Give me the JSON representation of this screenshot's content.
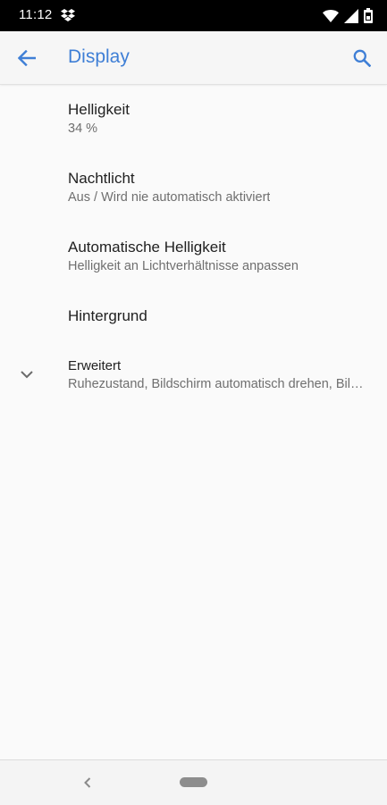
{
  "status_bar": {
    "time": "11:12",
    "icons": [
      "dropbox-icon",
      "wifi-icon",
      "signal-icon",
      "battery-icon"
    ]
  },
  "app_bar": {
    "title": "Display",
    "back_icon": "arrow-back-icon",
    "search_icon": "search-icon",
    "accent_color": "#3f7fd6"
  },
  "settings": {
    "items": [
      {
        "title": "Helligkeit",
        "summary": "34 %"
      },
      {
        "title": "Nachtlicht",
        "summary": "Aus / Wird nie automatisch aktiviert"
      },
      {
        "title": "Automatische Helligkeit",
        "summary": "Helligkeit an Lichtverhältnisse anpassen"
      },
      {
        "title": "Hintergrund",
        "summary": ""
      },
      {
        "title": "Erweitert",
        "summary": "Ruhezustand, Bildschirm automatisch drehen, Bildschirmschoner",
        "icon": "chevron-down-icon"
      }
    ]
  },
  "nav_bar": {
    "back_icon": "nav-back-icon",
    "home_icon": "home-pill-icon"
  }
}
